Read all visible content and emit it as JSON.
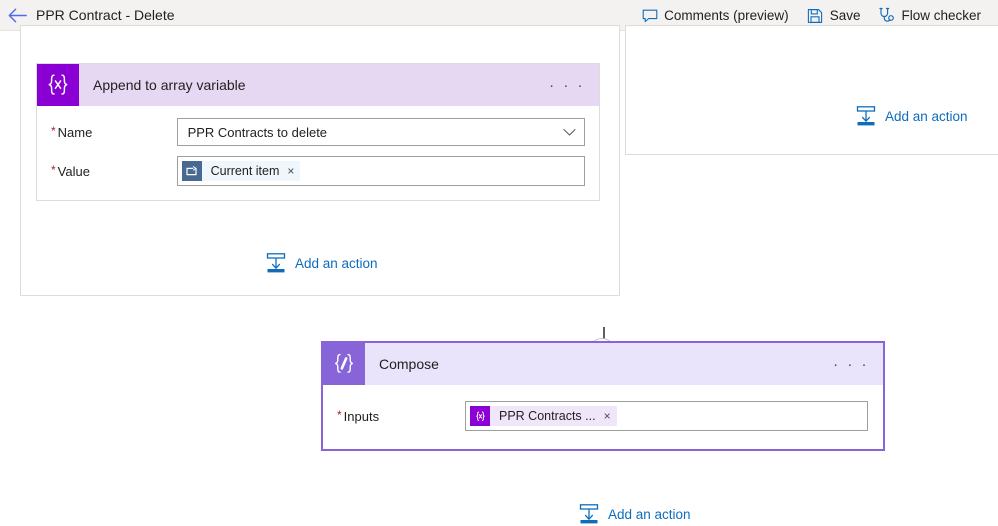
{
  "commandbar": {
    "back_icon": "arrow-left-icon",
    "title": "PPR Contract - Delete",
    "actions": [
      {
        "label": "Comments (preview)",
        "icon": "comment-icon"
      },
      {
        "label": "Save",
        "icon": "save-icon"
      },
      {
        "label": "Flow checker",
        "icon": "stethoscope-icon"
      }
    ]
  },
  "canvas": {
    "append_card": {
      "icon": "variable-braces-icon",
      "title": "Append to array variable",
      "ellipsis": "· · ·",
      "fields": [
        {
          "label": "Name",
          "required_marker": "*",
          "type": "dropdown",
          "value": "PPR Contracts to delete",
          "chevron": "chevron-down-icon"
        },
        {
          "label": "Value",
          "required_marker": "*",
          "type": "token",
          "token_label": "Current item",
          "token_icon": "apply-to-each-loop-icon",
          "token_remove": "×"
        }
      ]
    },
    "compose_card": {
      "icon": "compose-braces-icon",
      "title": "Compose",
      "ellipsis": "· · ·",
      "fields": [
        {
          "label": "Inputs",
          "required_marker": "*",
          "type": "token",
          "token_label": "PPR Contracts ...",
          "token_icon": "variable-braces-icon",
          "token_remove": "×"
        }
      ]
    },
    "add_action_inner": {
      "label": "Add an action",
      "icon": "add-action-icon"
    },
    "add_action_right": {
      "label": "Add an action",
      "icon": "add-action-icon"
    },
    "add_action_bottom": {
      "label": "Add an action",
      "icon": "add-action-icon"
    },
    "connector": {
      "plus": "plus-icon",
      "arrow": "arrow-down-icon"
    }
  },
  "colors": {
    "accent_link": "#0f6cbd",
    "variable_purple": "#8a00d4",
    "compose_purple": "#8764d8",
    "card_header_lavender": "#e6d7f2",
    "required_red": "#a4262c",
    "loop_token_blue": "#486991",
    "commandbar_bg": "#f3f2f1"
  }
}
